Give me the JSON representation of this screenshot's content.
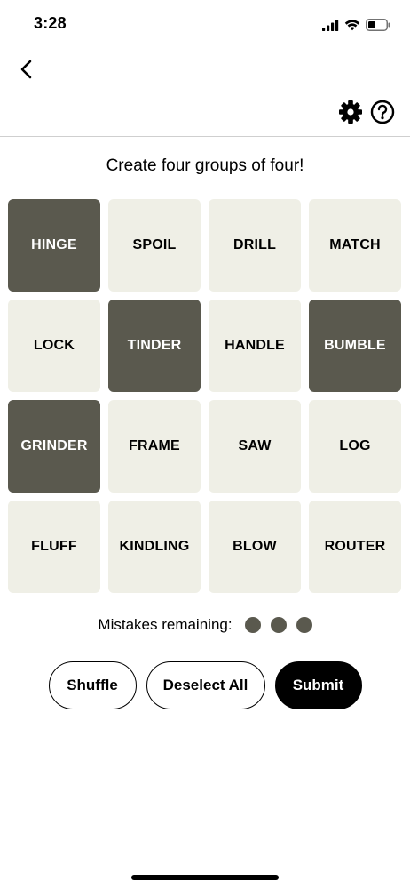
{
  "status_bar": {
    "time": "3:28"
  },
  "game": {
    "instructions": "Create four groups of four!",
    "tiles": [
      {
        "word": "HINGE",
        "selected": true
      },
      {
        "word": "SPOIL",
        "selected": false
      },
      {
        "word": "DRILL",
        "selected": false
      },
      {
        "word": "MATCH",
        "selected": false
      },
      {
        "word": "LOCK",
        "selected": false
      },
      {
        "word": "TINDER",
        "selected": true
      },
      {
        "word": "HANDLE",
        "selected": false
      },
      {
        "word": "BUMBLE",
        "selected": true
      },
      {
        "word": "GRINDER",
        "selected": true
      },
      {
        "word": "FRAME",
        "selected": false
      },
      {
        "word": "SAW",
        "selected": false
      },
      {
        "word": "LOG",
        "selected": false
      },
      {
        "word": "FLUFF",
        "selected": false
      },
      {
        "word": "KINDLING",
        "selected": false
      },
      {
        "word": "BLOW",
        "selected": false
      },
      {
        "word": "ROUTER",
        "selected": false
      }
    ],
    "mistakes_label": "Mistakes remaining:",
    "mistakes_remaining": 3
  },
  "buttons": {
    "shuffle": "Shuffle",
    "deselect_all": "Deselect All",
    "submit": "Submit"
  },
  "colors": {
    "tile_default": "#efefe6",
    "tile_selected": "#5a594e",
    "submit_bg": "#000000"
  },
  "icons": {
    "back": "chevron-left-icon",
    "settings": "gear-icon",
    "help": "question-circle-icon"
  }
}
